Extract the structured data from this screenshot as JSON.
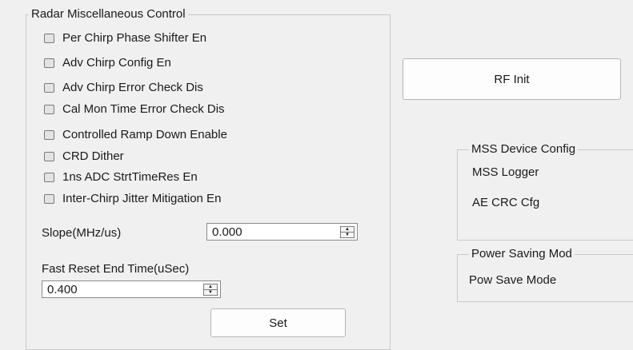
{
  "misc_group": {
    "title": "Radar Miscellaneous Control",
    "checkboxes": [
      {
        "label": "Per Chirp Phase Shifter En",
        "checked": false
      },
      {
        "label": "Adv Chirp Config En",
        "checked": false
      },
      {
        "label": "Adv Chirp Error Check Dis",
        "checked": false
      },
      {
        "label": "Cal Mon Time Error Check Dis",
        "checked": false
      },
      {
        "label": "Controlled Ramp Down Enable",
        "checked": false
      },
      {
        "label": "CRD Dither",
        "checked": false
      },
      {
        "label": "1ns ADC StrtTimeRes En",
        "checked": false
      },
      {
        "label": "Inter-Chirp Jitter Mitigation En",
        "checked": false
      }
    ],
    "slope_label": "Slope(MHz/us)",
    "slope_value": "0.000",
    "fast_reset_label": "Fast Reset End Time(uSec)",
    "fast_reset_value": "0.400",
    "set_label": "Set"
  },
  "rf_init_label": "RF Init",
  "mss_group": {
    "title": "MSS Device Config",
    "logger_label": "MSS Logger",
    "ae_crc_label": "AE CRC Cfg"
  },
  "power_group": {
    "title": "Power Saving Mod",
    "pow_save_label": "Pow Save Mode"
  }
}
